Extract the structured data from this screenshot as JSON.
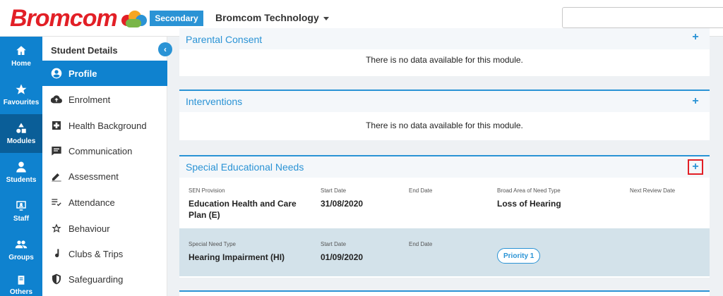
{
  "header": {
    "logo_text": "Bromcom",
    "school_type": "Secondary",
    "org_name": "Bromcom Technology",
    "colors": {
      "brand_red": "#e21f26",
      "accent_blue": "#2a93d5"
    }
  },
  "rail": {
    "items": [
      {
        "label": "Home",
        "icon": "home-icon"
      },
      {
        "label": "Favourites",
        "icon": "star-icon"
      },
      {
        "label": "Modules",
        "icon": "shapes-icon",
        "active": true
      },
      {
        "label": "Students",
        "icon": "person-icon"
      },
      {
        "label": "Staff",
        "icon": "staff-icon"
      },
      {
        "label": "Groups",
        "icon": "groups-icon"
      },
      {
        "label": "Others",
        "icon": "book-icon"
      }
    ]
  },
  "subnav": {
    "title": "Student Details",
    "items": [
      {
        "label": "Profile",
        "icon": "user-circle-icon",
        "active": true
      },
      {
        "label": "Enrolment",
        "icon": "cloud-upload-icon"
      },
      {
        "label": "Health Background",
        "icon": "medical-plus-icon"
      },
      {
        "label": "Communication",
        "icon": "chat-icon"
      },
      {
        "label": "Assessment",
        "icon": "pencil-icon"
      },
      {
        "label": "Attendance",
        "icon": "checklist-icon"
      },
      {
        "label": "Behaviour",
        "icon": "star-outline-icon"
      },
      {
        "label": "Clubs & Trips",
        "icon": "music-note-icon"
      },
      {
        "label": "Safeguarding",
        "icon": "shield-icon"
      }
    ]
  },
  "panels": {
    "parental_consent": {
      "title": "Parental Consent",
      "message": "There is no data available for this module."
    },
    "interventions": {
      "title": "Interventions",
      "message": "There is no data available for this module."
    },
    "sen": {
      "title": "Special Educational Needs",
      "row1": {
        "sen_provision_label": "SEN Provision",
        "sen_provision_value": "Education Health and Care Plan (E)",
        "start_date_label": "Start Date",
        "start_date_value": "31/08/2020",
        "end_date_label": "End Date",
        "broad_area_label": "Broad Area of Need Type",
        "broad_area_value": "Loss of Hearing",
        "next_review_label": "Next Review Date"
      },
      "row2": {
        "need_type_label": "Special Need Type",
        "need_type_value": "Hearing Impairment (HI)",
        "start_date_label": "Start Date",
        "start_date_value": "01/09/2020",
        "end_date_label": "End Date",
        "priority": "Priority 1"
      }
    }
  }
}
